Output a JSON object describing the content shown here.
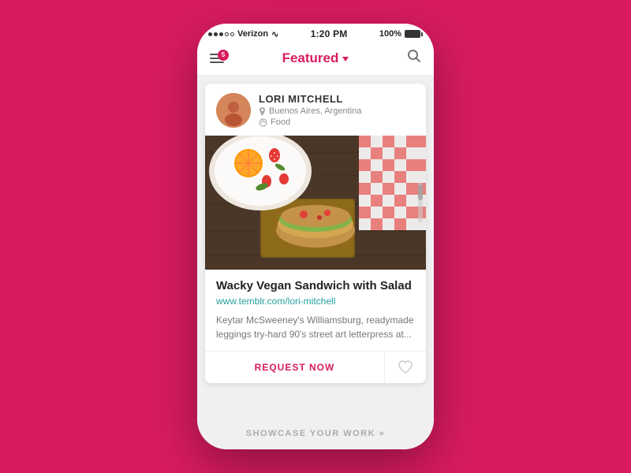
{
  "status_bar": {
    "carrier": "Verizon",
    "time": "1:20 PM",
    "battery": "100%",
    "signal_dots": [
      true,
      true,
      true,
      false,
      false
    ]
  },
  "nav": {
    "title": "Featured",
    "notification_count": "5",
    "menu_label": "Menu",
    "search_label": "Search"
  },
  "card": {
    "user": {
      "name": "LORI MITCHELL",
      "location": "Buenos Aires, Argentina",
      "category": "Food"
    },
    "post": {
      "title": "Wacky Vegan Sandwich with Salad",
      "link": "www.temblr.com/lori-mitchell",
      "excerpt": "Keytar McSweeney's Williamsburg, readymade leggings try-hard 90's street art letterpress at..."
    },
    "actions": {
      "request": "REQUEST NOW",
      "like": "♡"
    }
  },
  "footer": {
    "label": "SHOWCASE YOUR WORK »"
  }
}
